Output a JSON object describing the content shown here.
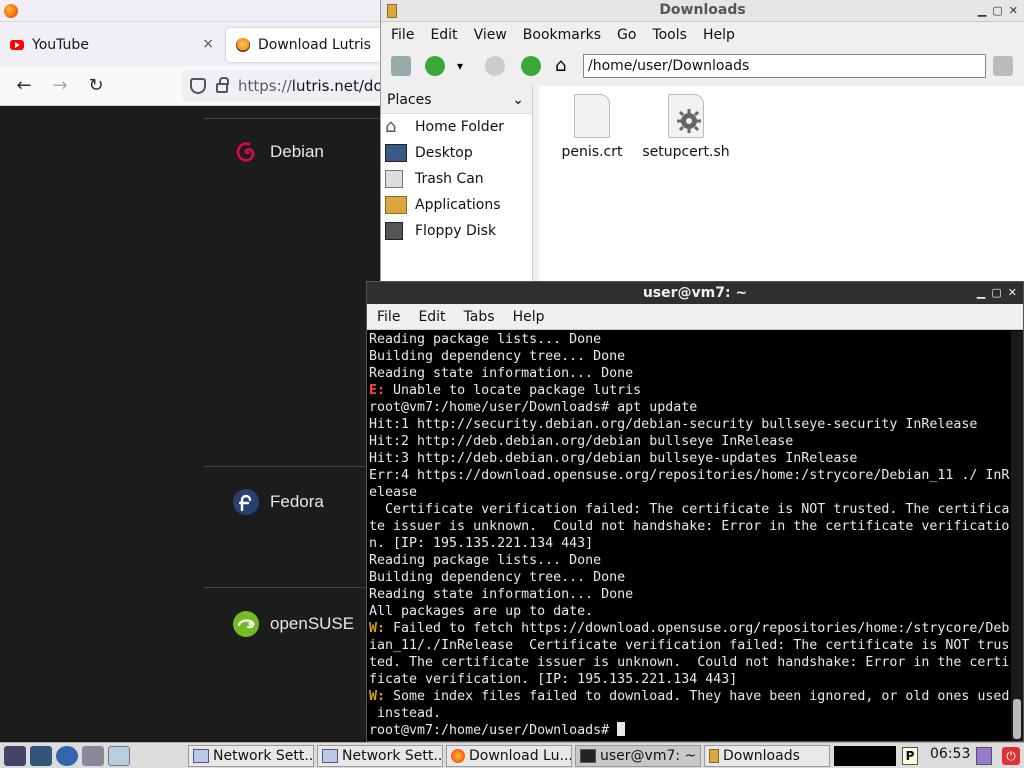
{
  "browser": {
    "tabs": [
      {
        "label": "YouTube",
        "close": "×"
      },
      {
        "label": "Download Lutris"
      }
    ],
    "url_scheme": "https://",
    "url_host": "lutris.net/do",
    "distros": [
      "Debian",
      "Fedora",
      "openSUSE"
    ]
  },
  "file_manager": {
    "title": "Downloads",
    "menu": [
      "File",
      "Edit",
      "View",
      "Bookmarks",
      "Go",
      "Tools",
      "Help"
    ],
    "path": "/home/user/Downloads",
    "places_label": "Places",
    "places": [
      "Home Folder",
      "Desktop",
      "Trash Can",
      "Applications",
      "Floppy Disk"
    ],
    "files": [
      "penis.crt",
      "setupcert.sh"
    ]
  },
  "terminal": {
    "title": "user@vm7: ~",
    "menu": [
      "File",
      "Edit",
      "Tabs",
      "Help"
    ],
    "lines": [
      {
        "t": "Reading package lists... Done"
      },
      {
        "t": "Building dependency tree... Done"
      },
      {
        "t": "Reading state information... Done"
      },
      {
        "p": "E:",
        "t": " Unable to locate package lutris",
        "k": "e"
      },
      {
        "t": "root@vm7:/home/user/Downloads# apt update"
      },
      {
        "t": "Hit:1 http://security.debian.org/debian-security bullseye-security InRelease"
      },
      {
        "t": "Hit:2 http://deb.debian.org/debian bullseye InRelease"
      },
      {
        "t": "Hit:3 http://deb.debian.org/debian bullseye-updates InRelease"
      },
      {
        "t": "Err:4 https://download.opensuse.org/repositories/home:/strycore/Debian_11 ./ InR"
      },
      {
        "t": "elease"
      },
      {
        "t": "  Certificate verification failed: The certificate is NOT trusted. The certifica"
      },
      {
        "t": "te issuer is unknown.  Could not handshake: Error in the certificate verificatio"
      },
      {
        "t": "n. [IP: 195.135.221.134 443]"
      },
      {
        "t": "Reading package lists... Done"
      },
      {
        "t": "Building dependency tree... Done"
      },
      {
        "t": "Reading state information... Done"
      },
      {
        "t": "All packages are up to date."
      },
      {
        "p": "W:",
        "t": " Failed to fetch https://download.opensuse.org/repositories/home:/strycore/Deb",
        "k": "w"
      },
      {
        "t": "ian_11/./InRelease  Certificate verification failed: The certificate is NOT trus"
      },
      {
        "t": "ted. The certificate issuer is unknown.  Could not handshake: Error in the certi"
      },
      {
        "t": "ficate verification. [IP: 195.135.221.134 443]"
      },
      {
        "p": "W:",
        "t": " Some index files failed to download. They have been ignored, or old ones used",
        "k": "w"
      },
      {
        "t": " instead."
      },
      {
        "t": "root@vm7:/home/user/Downloads# "
      }
    ]
  },
  "taskbar": {
    "tasks": [
      "Network Sett...",
      "Network Sett...",
      "Download Lu...",
      "user@vm7: ~",
      "Downloads"
    ],
    "clock": "06:53"
  }
}
